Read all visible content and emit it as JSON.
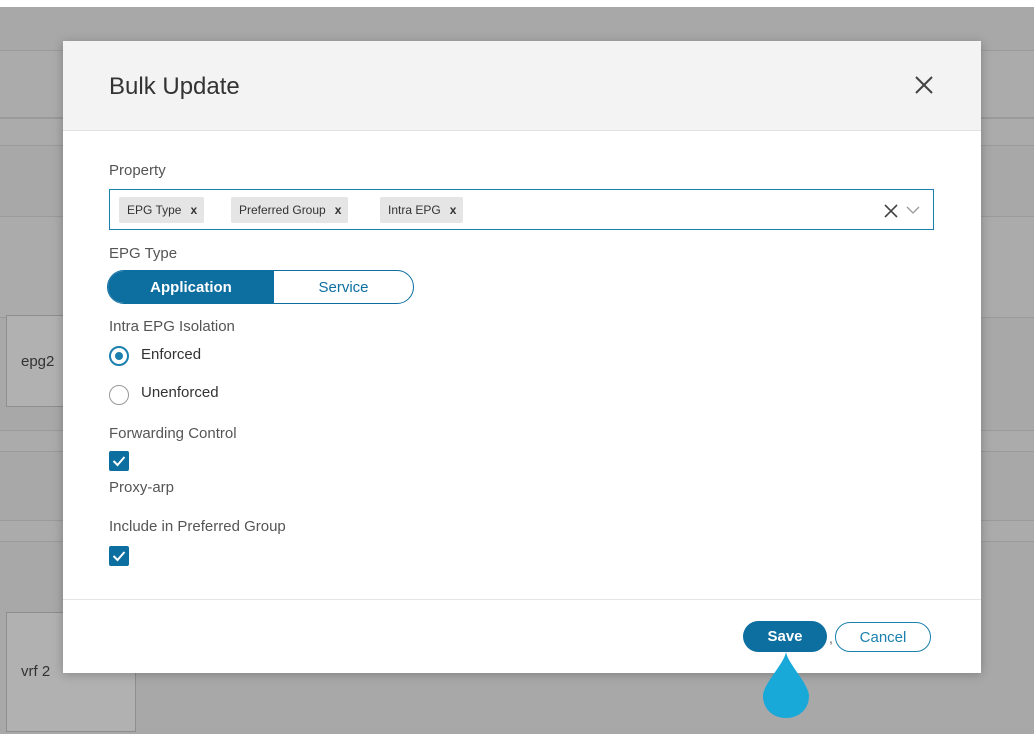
{
  "background": {
    "cells": [
      "epg2",
      "vrf 2"
    ]
  },
  "modal": {
    "title": "Bulk Update",
    "property": {
      "label": "Property",
      "tags": [
        "EPG Type",
        "Preferred Group",
        "Intra EPG"
      ],
      "tag_remove": "x"
    },
    "epg_type": {
      "label": "EPG Type",
      "options": [
        "Application",
        "Service"
      ],
      "selected": "Application"
    },
    "intra_epg_isolation": {
      "label": "Intra EPG Isolation",
      "options": [
        "Enforced",
        "Unenforced"
      ],
      "selected": "Enforced"
    },
    "forwarding_control": {
      "label": "Forwarding Control",
      "checked": true,
      "option_label": "Proxy-arp"
    },
    "preferred_group": {
      "label": "Include in Preferred Group",
      "checked": true
    },
    "footer": {
      "save_label": "Save",
      "separator": ",",
      "cancel_label": "Cancel"
    }
  },
  "colors": {
    "accent": "#0d6ea0",
    "focus_border": "#1b80ad",
    "pointer": "#18a9d9"
  }
}
